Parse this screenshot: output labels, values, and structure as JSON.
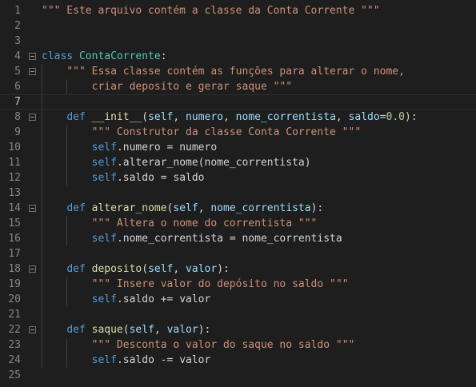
{
  "editor": {
    "lines": [
      {
        "n": "1",
        "tokens": [
          {
            "t": "\"\"\" Este arquivo contém a classe da Conta Corrente \"\"\"",
            "c": "str"
          }
        ]
      },
      {
        "n": "2",
        "tokens": []
      },
      {
        "n": "3",
        "tokens": []
      },
      {
        "n": "4",
        "fold": true,
        "tokens": [
          {
            "t": "class",
            "c": "kw"
          },
          {
            "t": " ",
            "c": "plain"
          },
          {
            "t": "ContaCorrente",
            "c": "cls"
          },
          {
            "t": ":",
            "c": "plain"
          }
        ]
      },
      {
        "n": "5",
        "fold": true,
        "tokens": [
          {
            "t": "    ",
            "c": "plain"
          },
          {
            "t": "\"\"\" Essa classe contém as funções para alterar o nome,",
            "c": "str"
          }
        ]
      },
      {
        "n": "6",
        "tokens": [
          {
            "t": "        ",
            "c": "plain"
          },
          {
            "t": "criar deposito e gerar saque \"\"\"",
            "c": "str"
          }
        ]
      },
      {
        "n": "7",
        "current": true,
        "tokens": []
      },
      {
        "n": "8",
        "fold": true,
        "tokens": [
          {
            "t": "    ",
            "c": "plain"
          },
          {
            "t": "def",
            "c": "kw"
          },
          {
            "t": " ",
            "c": "plain"
          },
          {
            "t": "__init__",
            "c": "fn"
          },
          {
            "t": "(",
            "c": "plain"
          },
          {
            "t": "self",
            "c": "param"
          },
          {
            "t": ", ",
            "c": "plain"
          },
          {
            "t": "numero",
            "c": "param"
          },
          {
            "t": ", ",
            "c": "plain"
          },
          {
            "t": "nome_correntista",
            "c": "param"
          },
          {
            "t": ", ",
            "c": "plain"
          },
          {
            "t": "saldo",
            "c": "param"
          },
          {
            "t": "=",
            "c": "op"
          },
          {
            "t": "0.0",
            "c": "num"
          },
          {
            "t": "):",
            "c": "plain"
          }
        ]
      },
      {
        "n": "9",
        "tokens": [
          {
            "t": "        ",
            "c": "plain"
          },
          {
            "t": "\"\"\" Construtor da classe Conta Corrente \"\"\"",
            "c": "str"
          }
        ]
      },
      {
        "n": "10",
        "tokens": [
          {
            "t": "        ",
            "c": "plain"
          },
          {
            "t": "self",
            "c": "self"
          },
          {
            "t": ".numero = numero",
            "c": "plain"
          }
        ]
      },
      {
        "n": "11",
        "tokens": [
          {
            "t": "        ",
            "c": "plain"
          },
          {
            "t": "self",
            "c": "self"
          },
          {
            "t": ".alterar_nome(nome_correntista)",
            "c": "plain"
          }
        ]
      },
      {
        "n": "12",
        "tokens": [
          {
            "t": "        ",
            "c": "plain"
          },
          {
            "t": "self",
            "c": "self"
          },
          {
            "t": ".saldo = saldo",
            "c": "plain"
          }
        ]
      },
      {
        "n": "13",
        "tokens": []
      },
      {
        "n": "14",
        "fold": true,
        "tokens": [
          {
            "t": "    ",
            "c": "plain"
          },
          {
            "t": "def",
            "c": "kw"
          },
          {
            "t": " ",
            "c": "plain"
          },
          {
            "t": "alterar_nome",
            "c": "fn"
          },
          {
            "t": "(",
            "c": "plain"
          },
          {
            "t": "self",
            "c": "param"
          },
          {
            "t": ", ",
            "c": "plain"
          },
          {
            "t": "nome_correntista",
            "c": "param"
          },
          {
            "t": "):",
            "c": "plain"
          }
        ]
      },
      {
        "n": "15",
        "tokens": [
          {
            "t": "        ",
            "c": "plain"
          },
          {
            "t": "\"\"\" Altera o nome do correntista \"\"\"",
            "c": "str"
          }
        ]
      },
      {
        "n": "16",
        "tokens": [
          {
            "t": "        ",
            "c": "plain"
          },
          {
            "t": "self",
            "c": "self"
          },
          {
            "t": ".nome_correntista = nome_correntista",
            "c": "plain"
          }
        ]
      },
      {
        "n": "17",
        "tokens": []
      },
      {
        "n": "18",
        "fold": true,
        "tokens": [
          {
            "t": "    ",
            "c": "plain"
          },
          {
            "t": "def",
            "c": "kw"
          },
          {
            "t": " ",
            "c": "plain"
          },
          {
            "t": "deposito",
            "c": "fn"
          },
          {
            "t": "(",
            "c": "plain"
          },
          {
            "t": "self",
            "c": "param"
          },
          {
            "t": ", ",
            "c": "plain"
          },
          {
            "t": "valor",
            "c": "param"
          },
          {
            "t": "):",
            "c": "plain"
          }
        ]
      },
      {
        "n": "19",
        "tokens": [
          {
            "t": "        ",
            "c": "plain"
          },
          {
            "t": "\"\"\" Insere valor do depósito no saldo \"\"\"",
            "c": "str"
          }
        ]
      },
      {
        "n": "20",
        "tokens": [
          {
            "t": "        ",
            "c": "plain"
          },
          {
            "t": "self",
            "c": "self"
          },
          {
            "t": ".saldo += valor",
            "c": "plain"
          }
        ]
      },
      {
        "n": "21",
        "tokens": []
      },
      {
        "n": "22",
        "fold": true,
        "tokens": [
          {
            "t": "    ",
            "c": "plain"
          },
          {
            "t": "def",
            "c": "kw"
          },
          {
            "t": " ",
            "c": "plain"
          },
          {
            "t": "saque",
            "c": "fn"
          },
          {
            "t": "(",
            "c": "plain"
          },
          {
            "t": "self",
            "c": "param"
          },
          {
            "t": ", ",
            "c": "plain"
          },
          {
            "t": "valor",
            "c": "param"
          },
          {
            "t": "):",
            "c": "plain"
          }
        ]
      },
      {
        "n": "23",
        "tokens": [
          {
            "t": "        ",
            "c": "plain"
          },
          {
            "t": "\"\"\" Desconta o valor do saque no saldo \"\"\"",
            "c": "str"
          }
        ]
      },
      {
        "n": "24",
        "tokens": [
          {
            "t": "        ",
            "c": "plain"
          },
          {
            "t": "self",
            "c": "self"
          },
          {
            "t": ".saldo -= valor",
            "c": "plain"
          }
        ]
      },
      {
        "n": "25",
        "tokens": []
      }
    ]
  },
  "colors": {
    "background": "#1e1e1e",
    "string": "#ce9178",
    "keyword": "#569cd6",
    "function": "#dcdcaa",
    "class": "#4ec9b0",
    "parameter": "#9cdcfe",
    "number": "#b5cea8",
    "line_number": "#858585"
  }
}
